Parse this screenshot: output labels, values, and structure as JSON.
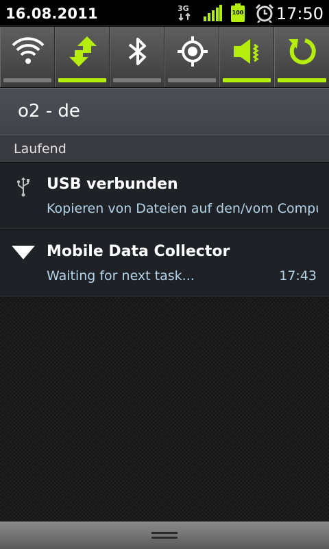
{
  "status_bar": {
    "date": "16.08.2011",
    "time": "17:50",
    "network_type": "3G",
    "battery_level": "100",
    "icons": [
      "3g-data-icon",
      "signal-strength-icon",
      "battery-icon",
      "alarm-clock-icon"
    ]
  },
  "toggles": [
    {
      "name": "wifi",
      "icon": "wifi-icon",
      "on": false
    },
    {
      "name": "mobile-data",
      "icon": "data-arrows-icon",
      "on": true
    },
    {
      "name": "bluetooth",
      "icon": "bluetooth-icon",
      "on": false
    },
    {
      "name": "gps",
      "icon": "gps-icon",
      "on": false
    },
    {
      "name": "sound",
      "icon": "speaker-icon",
      "on": true
    },
    {
      "name": "auto-rotate",
      "icon": "rotate-icon",
      "on": true
    }
  ],
  "carrier": "o2 - de",
  "section_title": "Laufend",
  "notifications": [
    {
      "title": "USB verbunden",
      "text": "Kopieren von Dateien auf den/vom Computer",
      "time": "",
      "icon": "usb-icon"
    },
    {
      "title": "Mobile Data Collector",
      "text": "Waiting for next task...",
      "time": "17:43",
      "icon": "triangle-down-icon"
    }
  ],
  "colors": {
    "accent": "#b5ee0c",
    "toggle_inactive": "#7a7a7a",
    "notification_text": "#b5d4ea",
    "background": "#1e2125"
  }
}
